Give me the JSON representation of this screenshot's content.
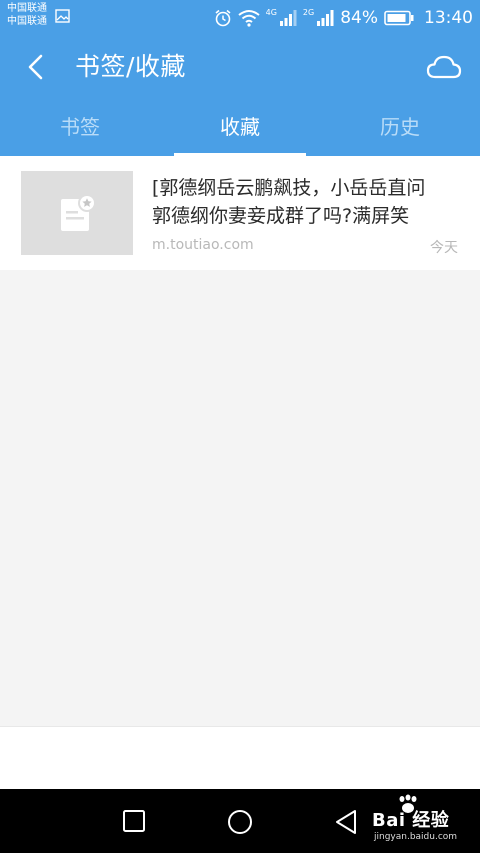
{
  "status_bar": {
    "carrier_1": "中国联通",
    "carrier_2": "中国联通",
    "net_1": "4G",
    "net_2": "2G",
    "battery": "84%",
    "time": "13:40"
  },
  "app_bar": {
    "title": "书签/收藏"
  },
  "tabs": [
    {
      "label": "书签",
      "active": false
    },
    {
      "label": "收藏",
      "active": true
    },
    {
      "label": "历史",
      "active": false
    }
  ],
  "favorites": [
    {
      "title_line_1": "[郭德纲岳云鹏飙技，小岳岳直问",
      "title_line_2": "郭德纲你妻妾成群了吗?满屏笑",
      "source": "m.toutiao.com",
      "time": "今天"
    }
  ],
  "watermark": {
    "main": "Bai 经验",
    "sub": "jingyan.baidu.com"
  },
  "colors": {
    "primary": "#4a9fe6",
    "tab_inactive": "#b9dcf8",
    "background": "#f4f4f4"
  }
}
